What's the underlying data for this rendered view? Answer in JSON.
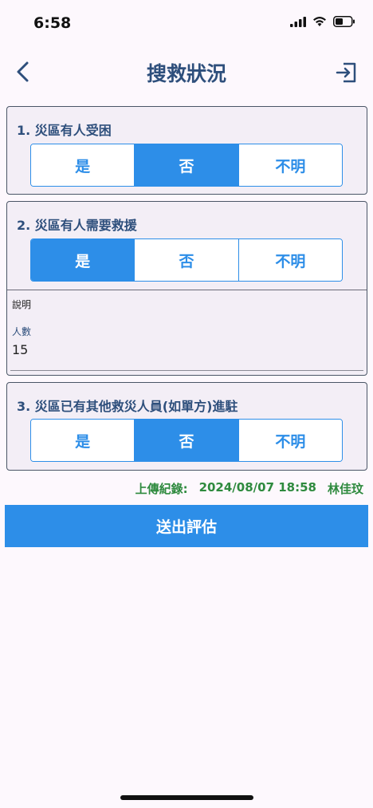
{
  "status": {
    "time": "6:58"
  },
  "header": {
    "title": "搜救狀況"
  },
  "questions": [
    {
      "label": "1. 災區有人受困",
      "options": [
        "是",
        "否",
        "不明"
      ],
      "selected": 1
    },
    {
      "label": "2. 災區有人需要救援",
      "options": [
        "是",
        "否",
        "不明"
      ],
      "selected": 0,
      "description_label": "說明",
      "count_label": "人數",
      "count_value": "15"
    },
    {
      "label": "3. 災區已有其他救災人員(如單方)進駐",
      "options": [
        "是",
        "否",
        "不明"
      ],
      "selected": 1
    }
  ],
  "upload": {
    "prefix": "上傳紀錄:",
    "datetime": "2024/08/07 18:58",
    "user": "林佳玟"
  },
  "submit_label": "送出評估",
  "colors": {
    "accent": "#2d8ee8",
    "title": "#2e4f7c",
    "record": "#2e8a3e"
  }
}
